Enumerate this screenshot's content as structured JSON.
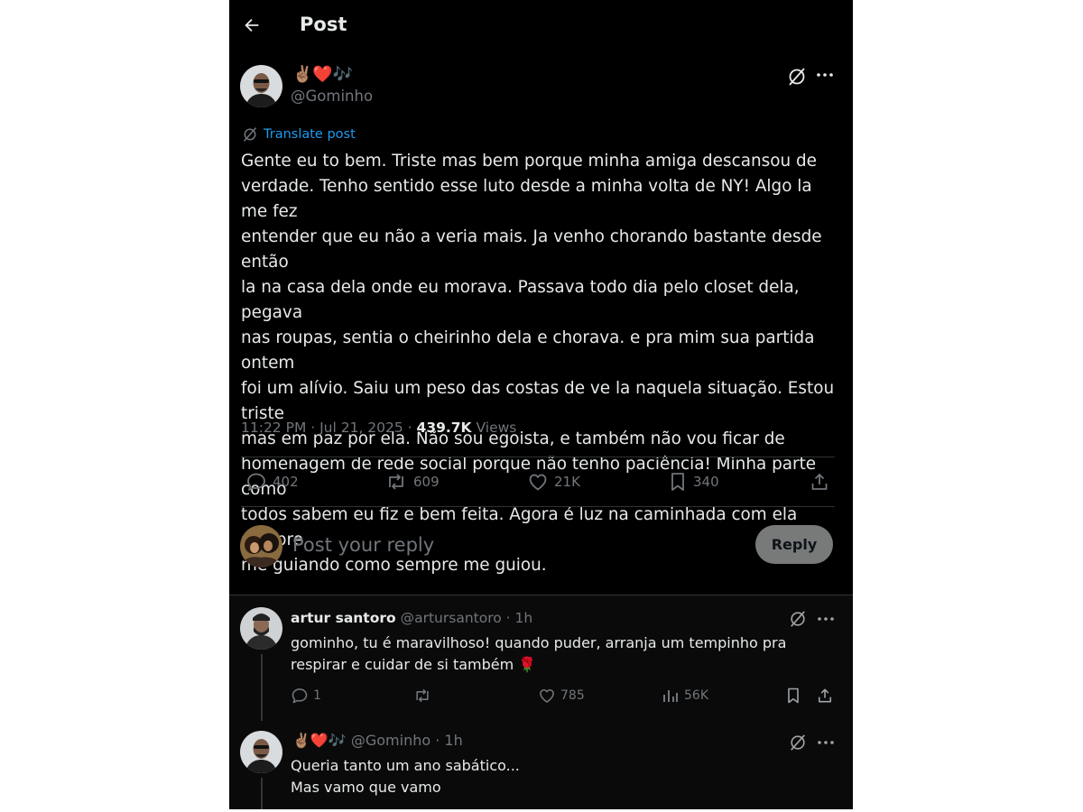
{
  "header": {
    "title": "Post"
  },
  "post": {
    "emoji_name": "✌🏽❤️🎶",
    "handle": "@Gominho",
    "translate": "Translate post",
    "text_lines": [
      "Gente eu to bem. Triste mas bem porque minha amiga descansou de",
      "verdade. Tenho sentido esse luto desde a minha volta de NY! Algo la me fez",
      "entender que eu não a veria mais. Ja venho chorando bastante desde então",
      "la na casa dela onde eu morava. Passava todo dia pelo closet dela, pegava",
      "nas roupas, sentia o cheirinho dela e chorava. e pra mim sua partida ontem",
      "foi um alívio. Saiu um peso das costas de ve la naquela situação. Estou triste",
      "mas em paz por ela. Não sou egoista, e também não vou ficar de",
      "homenagem de rede social porque não tenho paciência! Minha parte como",
      "todos sabem eu fiz e bem feita. Agora é luz na caminhada com ela sempre",
      "me guiando como sempre me guiou."
    ],
    "timestamp": "11:22 PM · Jul 21, 2025 · ",
    "views_count": "439.7K",
    "views_label": " Views",
    "stats": {
      "replies": "402",
      "reposts": "609",
      "likes": "21K",
      "bookmarks": "340"
    }
  },
  "composer": {
    "placeholder": "Post your reply",
    "button": "Reply"
  },
  "replies": [
    {
      "name": "artur santoro",
      "handle": "@artursantoro · 1h",
      "lines": [
        "gominho, tu é maravilhoso! quando puder, arranja um tempinho pra",
        "respirar e cuidar de si também 🌹"
      ],
      "stats": {
        "replies": "1",
        "likes": "785",
        "views": "56K"
      }
    },
    {
      "name": "✌🏽❤️🎶",
      "handle": "@Gominho · 1h",
      "lines": [
        "Queria tanto um ano sabático...",
        "Mas vamo que vamo"
      ]
    }
  ],
  "colors": {
    "background": "#000000",
    "text": "#e7e9ea",
    "muted": "#71767b",
    "link": "#1d9bf0",
    "reply_button": "#787a7a"
  }
}
